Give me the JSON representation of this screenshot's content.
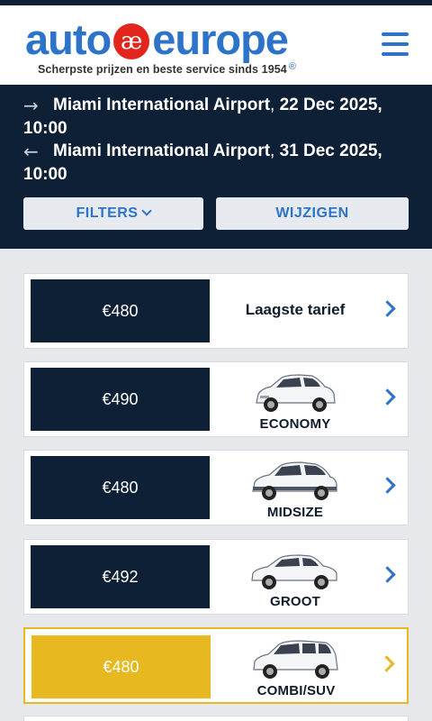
{
  "header": {
    "logo_left": "auto",
    "logo_badge": "æ",
    "logo_right": "europe",
    "logo_reg": "®",
    "tagline": "Scherpste prijzen en beste service sinds 1954"
  },
  "search": {
    "pickup": {
      "arrow": "→",
      "place": "Miami International Airport",
      "sep": ", ",
      "date": "22 Dec 2025, 10:00"
    },
    "dropoff": {
      "arrow": "←",
      "place": "Miami International Airport",
      "sep": ", ",
      "date": "31 Dec 2025, 10:00"
    },
    "filters_label": "FILTERS",
    "change_label": "WIJZIGEN"
  },
  "results": [
    {
      "price": "€480",
      "label": "Laagste tarief",
      "car": null
    },
    {
      "price": "€490",
      "label": "ECONOMY",
      "car": "hatchback-car-icon"
    },
    {
      "price": "€480",
      "label": "MIDSIZE",
      "car": "crossover-car-icon"
    },
    {
      "price": "€492",
      "label": "GROOT",
      "car": "sedan-car-icon"
    },
    {
      "price": "€480",
      "label": "COMBI/SUV",
      "car": "wagon-car-icon",
      "selected": true
    }
  ],
  "colors": {
    "navy": "#0e2036",
    "brand_blue": "#2c73c9",
    "badge_red": "#e2261d",
    "selected_yellow": "#e8b820"
  }
}
